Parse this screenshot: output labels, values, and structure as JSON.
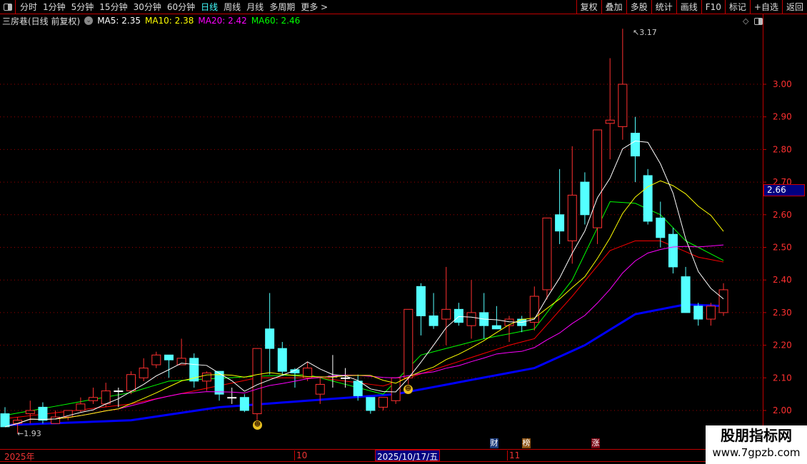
{
  "toolbar": {
    "periods": [
      "分时",
      "1分钟",
      "5分钟",
      "15分钟",
      "30分钟",
      "60分钟",
      "日线",
      "周线",
      "月线",
      "多周期",
      "更多 >"
    ],
    "active": "日线",
    "right_buttons": [
      "复权",
      "叠加",
      "多股",
      "统计",
      "画线",
      "F10",
      "标记",
      "+自选",
      "返回"
    ]
  },
  "info": {
    "title": "三房巷(日线 前复权)",
    "ma5": "MA5: 2.35",
    "ma10": "MA10: 2.38",
    "ma20": "MA20: 2.42",
    "ma60": "MA60: 2.46"
  },
  "colors": {
    "up": "#ff3030",
    "down": "#54ffff",
    "ma5": "#ffffff",
    "ma10": "#ffff00",
    "ma20": "#ff00ff",
    "ma60": "#00ff00",
    "line_red": "#ff0000",
    "line_blue": "#0000ff",
    "grid": "#a00000"
  },
  "chart_data": {
    "type": "candlestick",
    "ylim": [
      1.9,
      3.2
    ],
    "yticks": [
      "3.00",
      "2.90",
      "2.80",
      "2.70",
      "2.60",
      "2.50",
      "2.40",
      "2.30",
      "2.20",
      "2.10",
      "2.00"
    ],
    "ohlc": [
      [
        1.99,
        2.01,
        1.95,
        1.95
      ],
      [
        1.96,
        1.98,
        1.93,
        1.97
      ],
      [
        1.99,
        2.03,
        1.96,
        2.0
      ],
      [
        2.01,
        2.025,
        1.96,
        1.97
      ],
      [
        1.96,
        2.0,
        1.96,
        1.98
      ],
      [
        1.98,
        2.0,
        1.97,
        2.0
      ],
      [
        2.0,
        2.04,
        1.995,
        2.02
      ],
      [
        2.03,
        2.07,
        2.02,
        2.04
      ],
      [
        2.02,
        2.085,
        2.01,
        2.06
      ],
      [
        2.06,
        2.07,
        2.01,
        2.06
      ],
      [
        2.06,
        2.12,
        2.05,
        2.11
      ],
      [
        2.1,
        2.16,
        2.09,
        2.13
      ],
      [
        2.14,
        2.18,
        2.13,
        2.17
      ],
      [
        2.17,
        2.17,
        2.1,
        2.155
      ],
      [
        2.14,
        2.22,
        2.14,
        2.16
      ],
      [
        2.16,
        2.175,
        2.07,
        2.09
      ],
      [
        2.09,
        2.12,
        2.06,
        2.115
      ],
      [
        2.12,
        2.12,
        2.03,
        2.05
      ],
      [
        2.04,
        2.07,
        2.02,
        2.04
      ],
      [
        2.04,
        2.05,
        1.995,
        2.0
      ],
      [
        1.99,
        2.19,
        1.97,
        2.19
      ],
      [
        2.25,
        2.36,
        2.11,
        2.19
      ],
      [
        2.19,
        2.21,
        2.11,
        2.12
      ],
      [
        2.125,
        2.13,
        2.07,
        2.115
      ],
      [
        2.1,
        2.15,
        2.09,
        2.13
      ],
      [
        2.05,
        2.1,
        2.02,
        2.08
      ],
      [
        2.105,
        2.17,
        2.07,
        2.105
      ],
      [
        2.1,
        2.13,
        2.07,
        2.1
      ],
      [
        2.09,
        2.11,
        2.03,
        2.045
      ],
      [
        2.04,
        2.04,
        1.99,
        2.0
      ],
      [
        2.01,
        2.04,
        2.0,
        2.04
      ],
      [
        2.03,
        2.1,
        2.02,
        2.1
      ],
      [
        2.1,
        2.31,
        2.08,
        2.31
      ],
      [
        2.38,
        2.39,
        2.23,
        2.29
      ],
      [
        2.29,
        2.36,
        2.25,
        2.26
      ],
      [
        2.28,
        2.44,
        2.2,
        2.31
      ],
      [
        2.31,
        2.33,
        2.26,
        2.27
      ],
      [
        2.26,
        2.4,
        2.22,
        2.3
      ],
      [
        2.3,
        2.36,
        2.22,
        2.26
      ],
      [
        2.26,
        2.32,
        2.25,
        2.25
      ],
      [
        2.26,
        2.29,
        2.21,
        2.28
      ],
      [
        2.28,
        2.29,
        2.24,
        2.26
      ],
      [
        2.27,
        2.38,
        2.245,
        2.35
      ],
      [
        2.37,
        2.59,
        2.34,
        2.59
      ],
      [
        2.6,
        2.74,
        2.51,
        2.55
      ],
      [
        2.52,
        2.81,
        2.45,
        2.66
      ],
      [
        2.7,
        2.73,
        2.57,
        2.6
      ],
      [
        2.56,
        2.86,
        2.51,
        2.86
      ],
      [
        2.88,
        3.08,
        2.77,
        2.89
      ],
      [
        2.87,
        3.17,
        2.83,
        3.0
      ],
      [
        2.85,
        2.9,
        2.7,
        2.78
      ],
      [
        2.72,
        2.74,
        2.57,
        2.58
      ],
      [
        2.59,
        2.64,
        2.5,
        2.53
      ],
      [
        2.54,
        2.56,
        2.42,
        2.44
      ],
      [
        2.41,
        2.44,
        2.3,
        2.3
      ],
      [
        2.32,
        2.33,
        2.26,
        2.28
      ],
      [
        2.28,
        2.33,
        2.26,
        2.32
      ],
      [
        2.3,
        2.39,
        2.29,
        2.37
      ]
    ],
    "ma_windows": {
      "ma5": 5,
      "ma10": 10,
      "ma20": 20
    },
    "line_green": [
      [
        0,
        1.985
      ],
      [
        10,
        2.055
      ],
      [
        13,
        2.09
      ],
      [
        20,
        2.105
      ],
      [
        24,
        2.11
      ],
      [
        30,
        2.05
      ],
      [
        33,
        2.17
      ],
      [
        38,
        2.22
      ],
      [
        42,
        2.25
      ],
      [
        45,
        2.4
      ],
      [
        48,
        2.64
      ],
      [
        50,
        2.635
      ],
      [
        52,
        2.6
      ],
      [
        54,
        2.52
      ],
      [
        57,
        2.46
      ]
    ],
    "line_red": [
      [
        0,
        1.975
      ],
      [
        10,
        2.02
      ],
      [
        20,
        2.1
      ],
      [
        25,
        2.1
      ],
      [
        30,
        2.075
      ],
      [
        32,
        2.1
      ],
      [
        40,
        2.2
      ],
      [
        42,
        2.22
      ],
      [
        45,
        2.35
      ],
      [
        48,
        2.49
      ],
      [
        50,
        2.52
      ],
      [
        52,
        2.52
      ],
      [
        55,
        2.47
      ],
      [
        57,
        2.455
      ]
    ],
    "line_blue": [
      [
        0,
        1.955
      ],
      [
        10,
        1.97
      ],
      [
        17,
        2.01
      ],
      [
        31,
        2.05
      ],
      [
        42,
        2.13
      ],
      [
        46,
        2.2
      ],
      [
        50,
        2.295
      ],
      [
        54,
        2.325
      ],
      [
        57,
        2.32
      ]
    ],
    "high_label": "3.17",
    "low_label": "1.93",
    "current_price": "2.66"
  },
  "datebar": {
    "year": "2025年",
    "m10": "10",
    "selected": "2025/10/17/五",
    "m11": "11"
  },
  "badges": [
    "财",
    "榜",
    "涨"
  ],
  "watermark": {
    "line1": "股朋指标网",
    "line2": "www.7gpzb.com"
  }
}
